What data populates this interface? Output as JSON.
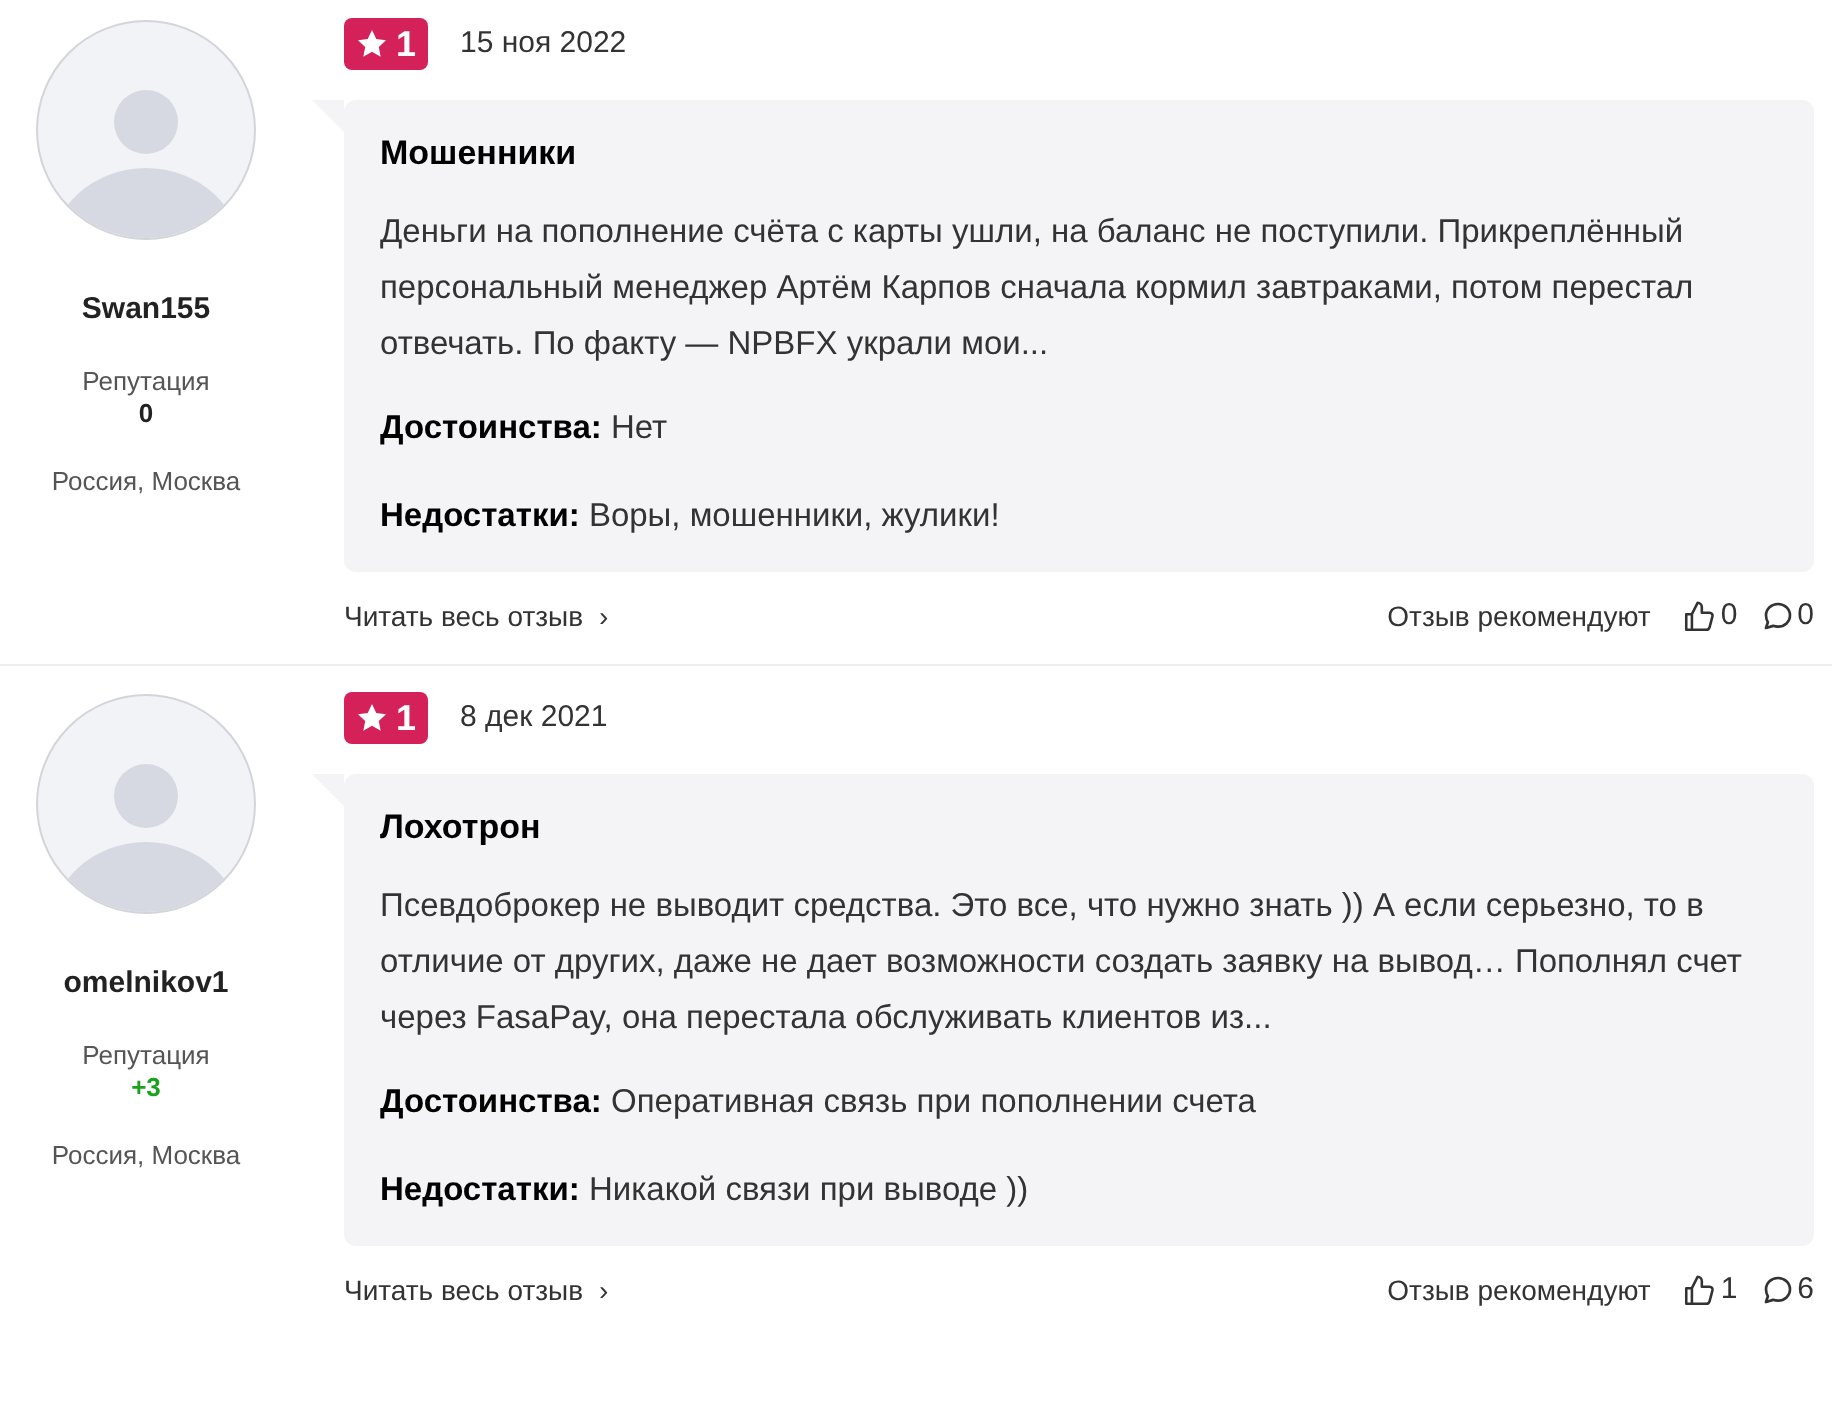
{
  "reviews": [
    {
      "author": "Swan155",
      "reputation_label": "Репутация",
      "reputation": {
        "value": "0",
        "color": "#222222"
      },
      "location": "Россия, Москва",
      "rating": "1",
      "date": "15 ноя 2022",
      "title": "Мошенники",
      "body": "Деньги на пополнение счёта с карты ушли, на баланс не поступили. Прикреплённый персональный менеджер Артём Карпов сначала кормил завтраками, потом перестал отвечать. По факту — NPBFX украли мои...",
      "pros_label": "Достоинства:",
      "pros": "Нет",
      "cons_label": "Недостатки:",
      "cons": "Воры, мошенники, жулики!",
      "read_more": "Читать весь отзыв",
      "chevron": "›",
      "recommend_label": "Отзыв рекомендуют",
      "likes": "0",
      "comments": "0"
    },
    {
      "author": "omelnikov1",
      "reputation_label": "Репутация",
      "reputation": {
        "value": "+3",
        "color": "#1aa31a"
      },
      "location": "Россия, Москва",
      "rating": "1",
      "date": "8 дек 2021",
      "title": "Лохотрон",
      "body": "Псевдоброкер не выводит средства. Это все, что нужно знать )) А если серьезно, то в отличие от других, даже не дает возможности создать заявку на вывод… Пополнял счет через FasaPay, она перестала обслуживать клиентов из...",
      "pros_label": "Достоинства:",
      "pros": "Оперативная связь при пополнении счета",
      "cons_label": "Недостатки:",
      "cons": "Никакой связи при выводе ))",
      "read_more": "Читать весь отзыв",
      "chevron": "›",
      "recommend_label": "Отзыв рекомендуют",
      "likes": "1",
      "comments": "6"
    }
  ]
}
